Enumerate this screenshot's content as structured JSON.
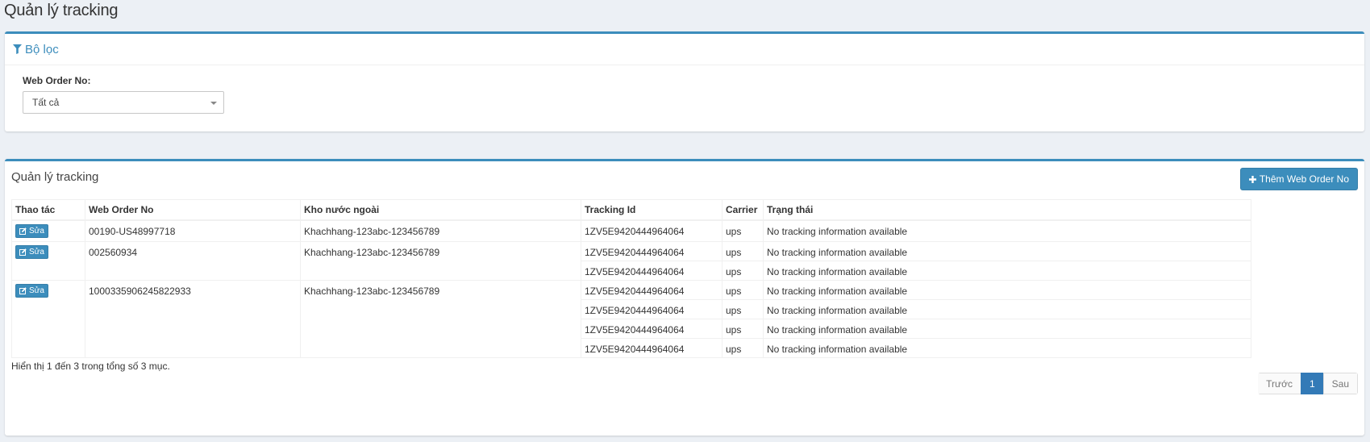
{
  "page": {
    "title": "Quản lý tracking"
  },
  "filter": {
    "header": "Bộ lọc",
    "web_order_label": "Web Order No:",
    "web_order_value": "Tất cả"
  },
  "table_section": {
    "title": "Quản lý tracking",
    "add_button_label": "Thêm Web Order No",
    "columns": [
      "Thao tác",
      "Web Order No",
      "Kho nước ngoài",
      "Tracking Id",
      "Carrier",
      "Trạng thái"
    ],
    "edit_label": "Sửa",
    "orders": [
      {
        "web_order_no": "00190-US48997718",
        "warehouse": "Khachhang-123abc-123456789",
        "trackings": [
          {
            "tracking_id": "1ZV5E9420444964064",
            "carrier": "ups",
            "status": "No tracking information available"
          }
        ]
      },
      {
        "web_order_no": "002560934",
        "warehouse": "Khachhang-123abc-123456789",
        "trackings": [
          {
            "tracking_id": "1ZV5E9420444964064",
            "carrier": "ups",
            "status": "No tracking information available"
          },
          {
            "tracking_id": "1ZV5E9420444964064",
            "carrier": "ups",
            "status": "No tracking information available"
          }
        ]
      },
      {
        "web_order_no": "1000335906245822933",
        "warehouse": "Khachhang-123abc-123456789",
        "trackings": [
          {
            "tracking_id": "1ZV5E9420444964064",
            "carrier": "ups",
            "status": "No tracking information available"
          },
          {
            "tracking_id": "1ZV5E9420444964064",
            "carrier": "ups",
            "status": "No tracking information available"
          },
          {
            "tracking_id": "1ZV5E9420444964064",
            "carrier": "ups",
            "status": "No tracking information available"
          },
          {
            "tracking_id": "1ZV5E9420444964064",
            "carrier": "ups",
            "status": "No tracking information available"
          }
        ]
      }
    ],
    "info_text": "Hiển thị 1 đến 3 trong tổng số 3 mục.",
    "pagination": {
      "prev": "Trước",
      "current": "1",
      "next": "Sau"
    }
  },
  "colors": {
    "primary": "#3c8dbc",
    "background": "#ecf0f5"
  },
  "icons": {
    "filter": "filter-icon",
    "add": "plus-icon",
    "edit": "edit-icon"
  }
}
